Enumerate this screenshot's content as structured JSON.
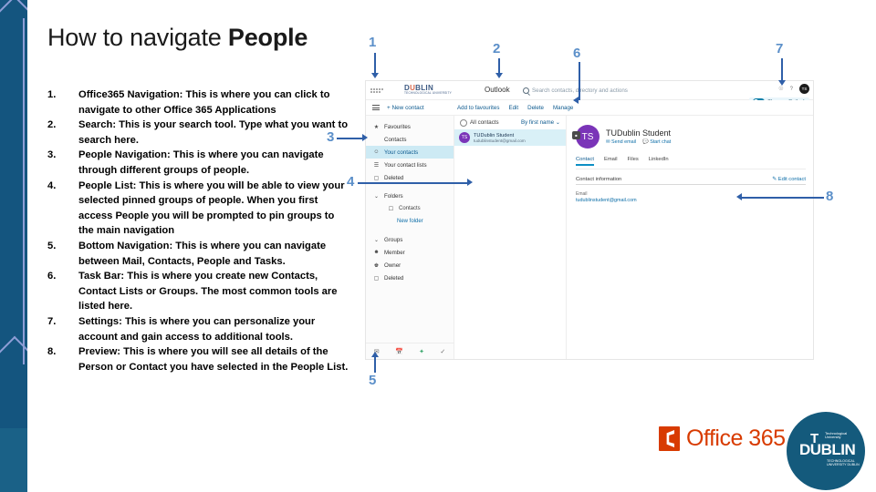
{
  "slide": {
    "title_normal": "How to navigate ",
    "title_bold": "People"
  },
  "list": [
    {
      "num": "1.",
      "text": "Office365 Navigation: This is where you can click to navigate to other Office 365 Applications"
    },
    {
      "num": "2.",
      "text": "Search: This is your search tool. Type what you want to search here."
    },
    {
      "num": "3.",
      "text": "People Navigation: This is where you can navigate through different groups of people."
    },
    {
      "num": "4.",
      "text": "People List: This is where you will be able to view your selected pinned groups of people. When you first access People you will be prompted to pin groups to the main navigation"
    },
    {
      "num": "5.",
      "text": "Bottom Navigation: This is where you can navigate between Mail, Contacts, People and Tasks."
    },
    {
      "num": "6.",
      "text": "Task Bar: This is where you create new Contacts, Contact Lists or Groups. The most common tools are listed here."
    },
    {
      "num": "7.",
      "text": "Settings: This is where you can personalize your account and gain access to additional tools."
    },
    {
      "num": "8.",
      "text": "Preview: This is where you will see all details of the Person or Contact you have selected in the People List."
    }
  ],
  "callouts": [
    {
      "label": "1"
    },
    {
      "label": "2"
    },
    {
      "label": "3"
    },
    {
      "label": "4"
    },
    {
      "label": "5"
    },
    {
      "label": "6"
    },
    {
      "label": "7"
    },
    {
      "label": "8"
    }
  ],
  "screenshot": {
    "brand": "D",
    "brand_u": "U",
    "brand_rest": "BLIN",
    "brand_sub": "TECHNOLOGICAL UNIVERSITY",
    "app_name": "Outlook",
    "search_placeholder": "Search contacts, directory and actions",
    "new_outlook_toggle": "The new Outlook",
    "new_contact": "+ New contact",
    "taskbar": [
      "Add to favourites",
      "Edit",
      "Delete",
      "Manage"
    ],
    "nav": [
      {
        "icon": "star",
        "label": "Favourites"
      },
      {
        "icon": "person",
        "label": "Contacts"
      },
      {
        "icon": "person",
        "label": "Your contacts",
        "selected": true
      },
      {
        "icon": "list",
        "label": "Your contact lists"
      },
      {
        "icon": "trash",
        "label": "Deleted"
      },
      {
        "icon": "chevron",
        "label": "Folders"
      },
      {
        "icon": "folder",
        "label": "Contacts",
        "sub": true
      },
      {
        "icon": "plus",
        "label": "New folder",
        "sub2": true
      },
      {
        "icon": "chevron",
        "label": "Groups"
      },
      {
        "icon": "people",
        "label": "Member"
      },
      {
        "icon": "crown",
        "label": "Owner"
      },
      {
        "icon": "trash",
        "label": "Deleted"
      }
    ],
    "bottom_nav": [
      "mail-icon",
      "calendar-icon",
      "people-icon",
      "tasks-icon"
    ],
    "list_header": {
      "title": "All contacts",
      "sort": "By first name"
    },
    "contact": {
      "initials": "TS",
      "name": "TUDublin Student",
      "email": "tudublinstudent@gmail.com"
    },
    "preview": {
      "initials": "TS",
      "name": "TUDublin Student",
      "actions": [
        "Send email",
        "Start chat"
      ],
      "tabs": [
        "Contact",
        "Email",
        "Files",
        "LinkedIn"
      ],
      "section_title": "Contact information",
      "edit_label": "Edit contact",
      "field_label": "Email",
      "field_value": "tudublinstudent@gmail.com"
    }
  },
  "footer": {
    "office_word": "Office 365",
    "tud_t": "T",
    "tud_du": "DU",
    "tud_blin": "BLIN",
    "tud_small_top": "Technological University",
    "tud_small_bottom": "TECHNOLOGICAL UNIVERSITY DUBLIN"
  },
  "colors": {
    "band": "#14557f",
    "accent_arrow": "#2f5fa8",
    "callout_number": "#5b8fc9",
    "office_orange": "#d83b01",
    "tud_blue": "#145a7c"
  }
}
